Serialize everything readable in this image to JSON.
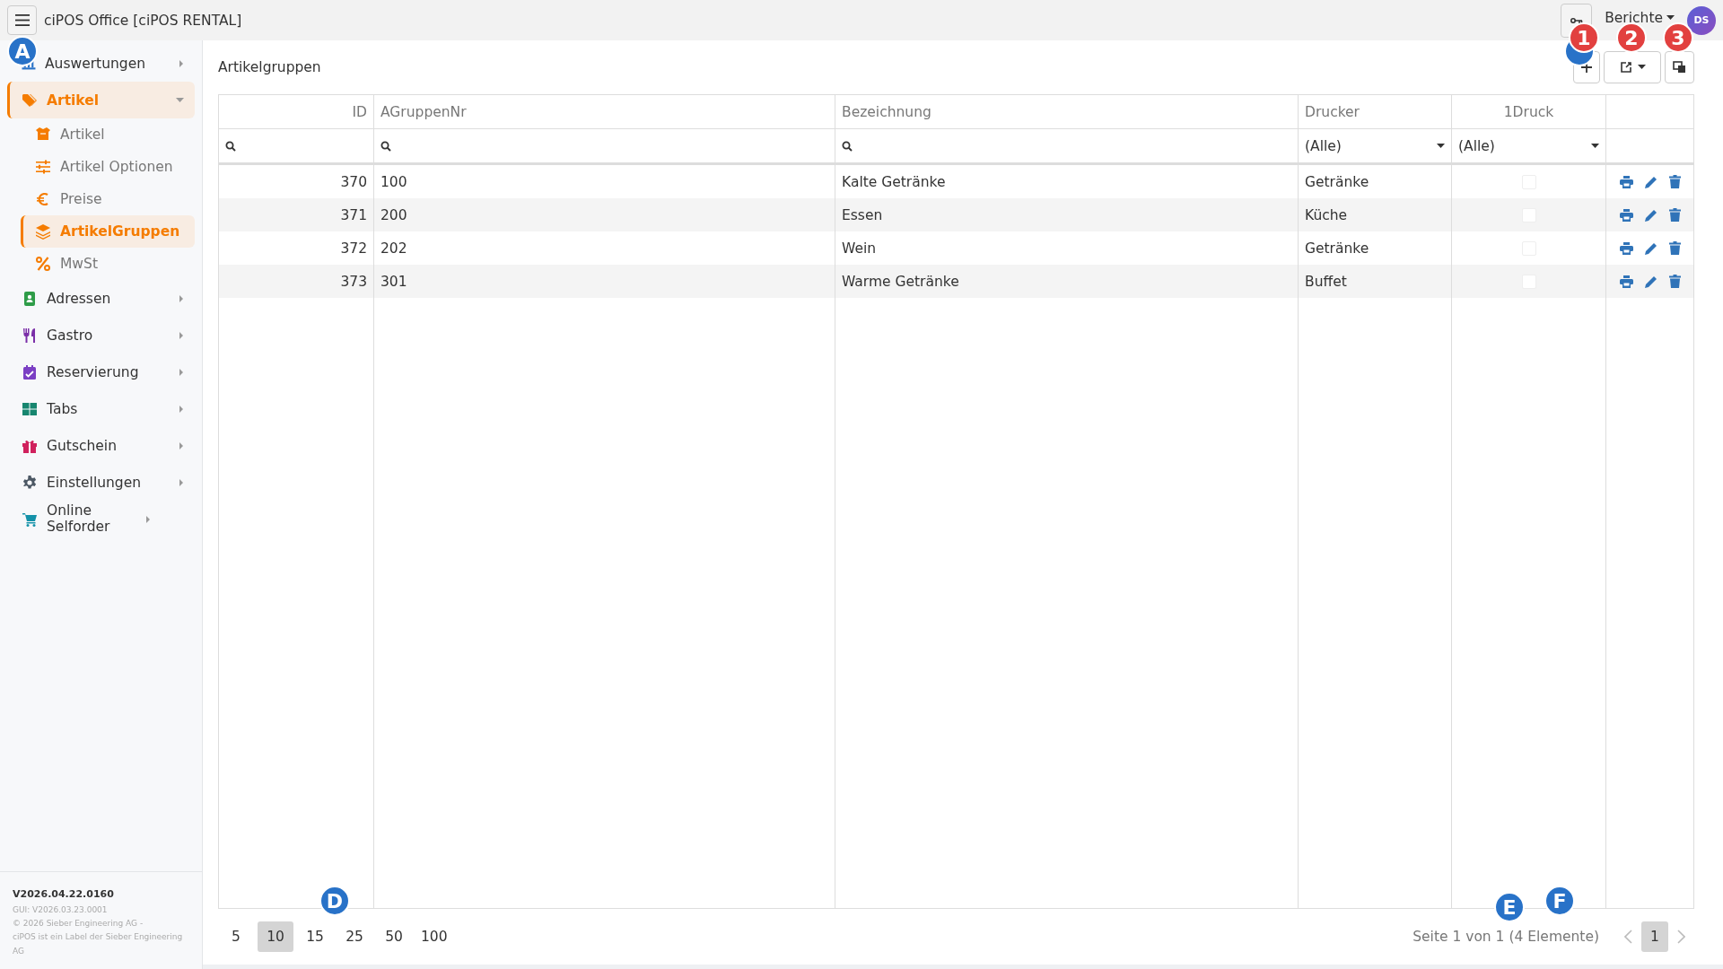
{
  "app_title": "ciPOS Office [ciPOS RENTAL]",
  "header": {
    "reports_menu": "Berichte",
    "avatar": "DS"
  },
  "sidebar": {
    "items": [
      {
        "label": "Auswertungen",
        "selected": false,
        "expanded": false
      },
      {
        "label": "Artikel",
        "selected": true,
        "expanded": true,
        "children": [
          {
            "label": "Artikel",
            "selected": false
          },
          {
            "label": "Artikel Optionen",
            "selected": false
          },
          {
            "label": "Preise",
            "selected": false
          },
          {
            "label": "ArtikelGruppen",
            "selected": true
          },
          {
            "label": "MwSt",
            "selected": false
          }
        ]
      },
      {
        "label": "Adressen",
        "selected": false,
        "expanded": false
      },
      {
        "label": "Gastro",
        "selected": false,
        "expanded": false
      },
      {
        "label": "Reservierung",
        "selected": false,
        "expanded": false
      },
      {
        "label": "Tabs",
        "selected": false,
        "expanded": false
      },
      {
        "label": "Gutschein",
        "selected": false,
        "expanded": false
      },
      {
        "label": "Einstellungen",
        "selected": false,
        "expanded": false
      },
      {
        "label": "Online Selforder",
        "selected": false,
        "expanded": false
      }
    ],
    "footer": {
      "version": "V2026.04.22.0160",
      "gui": "GUI: V2026.03.23.0001",
      "copyright": "© 2026 Sieber Engineering AG -",
      "label_note": "ciPOS ist ein Label der Sieber Engineering AG"
    }
  },
  "page_title": "Artikelgruppen",
  "table": {
    "columns": [
      "ID",
      "AGruppenNr",
      "Bezeichnung",
      "Drucker",
      "1Druck"
    ],
    "filters": [
      {
        "kind": "search"
      },
      {
        "kind": "search"
      },
      {
        "kind": "search"
      },
      {
        "kind": "select",
        "value": "(Alle)"
      },
      {
        "kind": "select",
        "value": "(Alle)"
      }
    ],
    "rows": [
      {
        "id": "370",
        "group_no": "100",
        "name": "Kalte Getränke",
        "printer": "Getränke",
        "single_print": false
      },
      {
        "id": "371",
        "group_no": "200",
        "name": "Essen",
        "printer": "Küche",
        "single_print": false
      },
      {
        "id": "372",
        "group_no": "202",
        "name": "Wein",
        "printer": "Getränke",
        "single_print": false
      },
      {
        "id": "373",
        "group_no": "301",
        "name": "Warme Getränke",
        "printer": "Buffet",
        "single_print": false
      }
    ]
  },
  "pager": {
    "page_sizes": [
      {
        "label": "5",
        "selected": false
      },
      {
        "label": "10",
        "selected": true
      },
      {
        "label": "15",
        "selected": false
      },
      {
        "label": "25",
        "selected": false
      },
      {
        "label": "50",
        "selected": false
      },
      {
        "label": "100",
        "selected": false
      }
    ],
    "summary": "Seite 1 von 1 (4 Elemente)",
    "pages": [
      {
        "label": "1",
        "selected": true
      }
    ]
  },
  "callouts": [
    {
      "label": "A",
      "color": "#2872c8"
    },
    {
      "color": "#2872c8"
    },
    {
      "label": "1",
      "color": "#e2403f"
    },
    {
      "label": "2",
      "color": "#e2403f"
    },
    {
      "label": "3",
      "color": "#e2403f"
    },
    {
      "label": "D",
      "color": "#2872c8"
    },
    {
      "label": "E",
      "color": "#2872c8"
    },
    {
      "label": "F",
      "color": "#2872c8"
    }
  ]
}
